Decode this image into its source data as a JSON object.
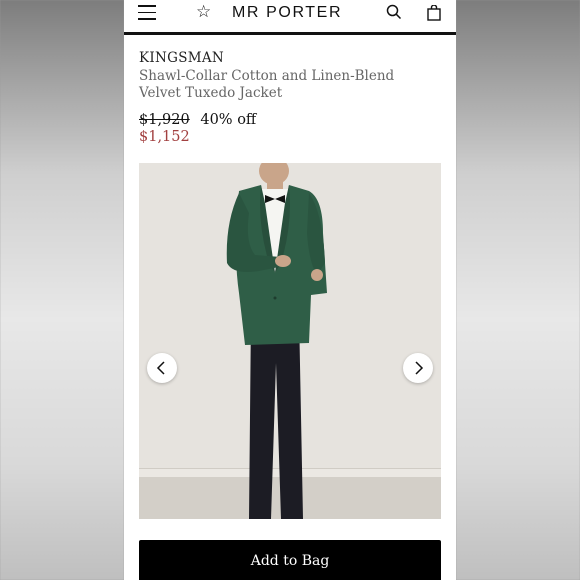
{
  "header": {
    "logo": "MR PORTER",
    "icons": [
      "menu-icon",
      "star-icon",
      "search-icon",
      "bag-icon"
    ]
  },
  "product": {
    "brand": "KINGSMAN",
    "title": "Shawl-Collar Cotton and Linen-Blend Velvet Tuxedo Jacket",
    "original_price": "$1,920",
    "discount": "40% off",
    "sale_price": "$1,152"
  },
  "gallery": {
    "prev_icon": "chevron-left-icon",
    "next_icon": "chevron-right-icon"
  },
  "actions": {
    "add_to_bag": "Add to Bag"
  },
  "colors": {
    "sale_price": "#a24040",
    "button_bg": "#000000",
    "jacket": "#2f5e47"
  }
}
